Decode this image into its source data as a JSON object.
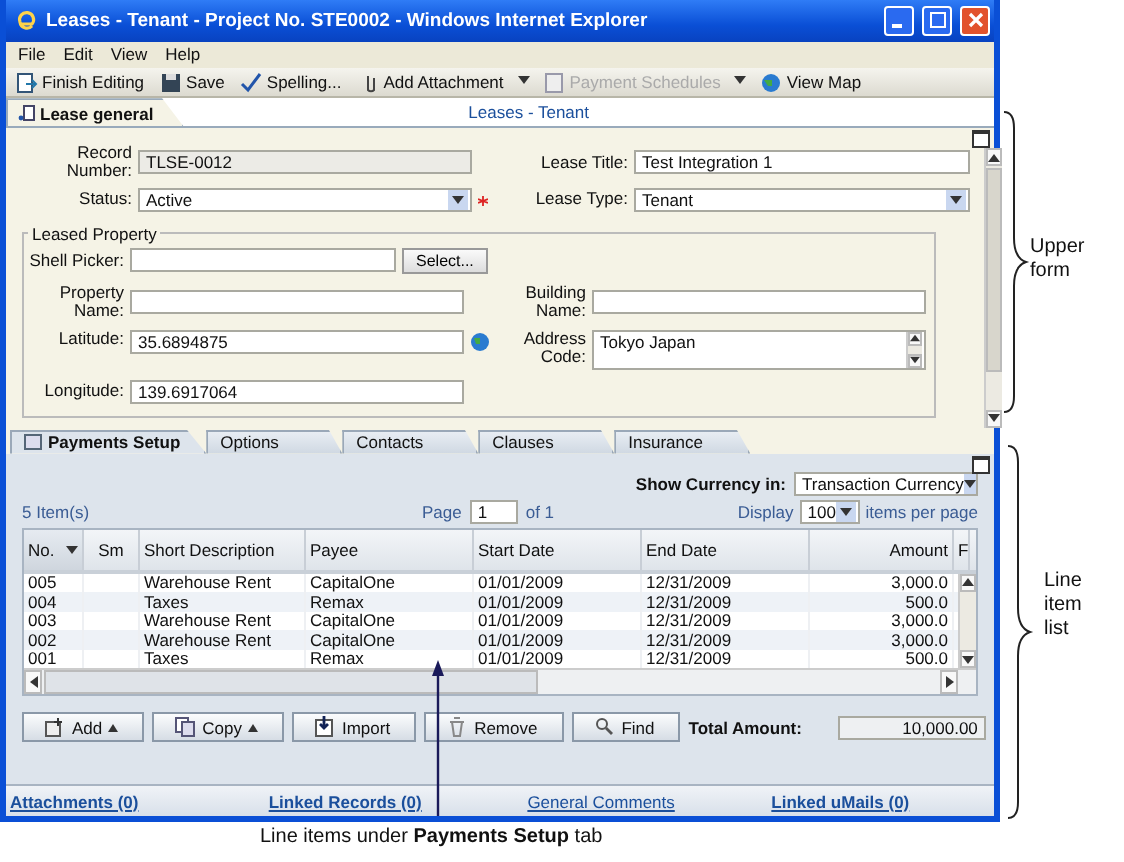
{
  "window": {
    "title": "Leases - Tenant - Project No. STE0002 - Windows Internet Explorer"
  },
  "menu": [
    "File",
    "Edit",
    "View",
    "Help"
  ],
  "toolbar": [
    {
      "label": "Finish Editing",
      "kind": "button",
      "disabled": false
    },
    {
      "label": "Save",
      "kind": "button",
      "disabled": false
    },
    {
      "label": "Spelling...",
      "kind": "button",
      "disabled": false
    },
    {
      "label": "Add Attachment",
      "kind": "split",
      "disabled": false
    },
    {
      "label": "Payment Schedules",
      "kind": "split",
      "disabled": true
    },
    {
      "label": "View Map",
      "kind": "button",
      "disabled": false
    }
  ],
  "upper_form": {
    "tab": "Lease general",
    "heading": "Leases - Tenant",
    "record_number": {
      "label": "Record Number:",
      "value": "TLSE-0012"
    },
    "status": {
      "label": "Status:",
      "value": "Active",
      "required": true
    },
    "lease_title": {
      "label": "Lease Title:",
      "value": "Test Integration 1"
    },
    "lease_type": {
      "label": "Lease Type:",
      "value": "Tenant"
    },
    "leased_property": {
      "legend": "Leased Property",
      "shell_picker": {
        "label": "Shell Picker:",
        "button": "Select..."
      },
      "property_name": {
        "label": "Property Name:"
      },
      "building_name": {
        "label": "Building Name:"
      },
      "latitude": {
        "label": "Latitude:",
        "value": "35.6894875"
      },
      "address_code": {
        "label": "Address Code:",
        "value": "Tokyo Japan"
      },
      "longitude": {
        "label": "Longitude:",
        "value": "139.6917064"
      }
    }
  },
  "lower_tabs": [
    {
      "label": "Payments Setup",
      "selected": true
    },
    {
      "label": "Options",
      "selected": false
    },
    {
      "label": "Contacts",
      "selected": false
    },
    {
      "label": "Clauses",
      "selected": false
    },
    {
      "label": "Insurance",
      "selected": false
    }
  ],
  "line_items": {
    "currency": {
      "label": "Show Currency in:",
      "value": "Transaction Currency"
    },
    "count": "5 Item(s)",
    "page": {
      "label": "Page",
      "value": "1",
      "total": "of 1"
    },
    "display": {
      "label": "Display",
      "value": "100",
      "suffix": "items per page"
    },
    "columns": [
      {
        "label": "No.",
        "sorted": true
      },
      {
        "label": "Sm",
        "sorted": false
      },
      {
        "label": "Short Description",
        "sorted": false
      },
      {
        "label": "Payee",
        "sorted": false
      },
      {
        "label": "Start Date",
        "sorted": false
      },
      {
        "label": "End Date",
        "sorted": false
      },
      {
        "label": "Amount",
        "sorted": false
      },
      {
        "label": "F",
        "sorted": false
      }
    ],
    "rows": [
      {
        "no": "005",
        "description": "Warehouse Rent",
        "payee": "CapitalOne",
        "start": "01/01/2009",
        "end": "12/31/2009",
        "amount": "3,000.0"
      },
      {
        "no": "004",
        "description": "Taxes",
        "payee": "Remax",
        "start": "01/01/2009",
        "end": "12/31/2009",
        "amount": "500.0"
      },
      {
        "no": "003",
        "description": "Warehouse Rent",
        "payee": "CapitalOne",
        "start": "01/01/2009",
        "end": "12/31/2009",
        "amount": "3,000.0"
      },
      {
        "no": "002",
        "description": "Warehouse Rent",
        "payee": "CapitalOne",
        "start": "01/01/2009",
        "end": "12/31/2009",
        "amount": "3,000.0"
      },
      {
        "no": "001",
        "description": "Taxes",
        "payee": "Remax",
        "start": "01/01/2009",
        "end": "12/31/2009",
        "amount": "500.0"
      }
    ],
    "buttons": [
      {
        "label": "Add",
        "kind": "menu"
      },
      {
        "label": "Copy",
        "kind": "menu"
      },
      {
        "label": "Import",
        "kind": "button"
      },
      {
        "label": "Remove",
        "kind": "button"
      },
      {
        "label": "Find",
        "kind": "button"
      }
    ],
    "total": {
      "label": "Total Amount:",
      "value": "10,000.00"
    }
  },
  "footer_links": [
    "Attachments (0)",
    "Linked Records (0)",
    "General Comments",
    "Linked uMails (0)"
  ],
  "annotations": [
    {
      "text": "Upper form"
    },
    {
      "text": "Line item list"
    }
  ],
  "caption": "Line items under **Payments Setup** tab"
}
